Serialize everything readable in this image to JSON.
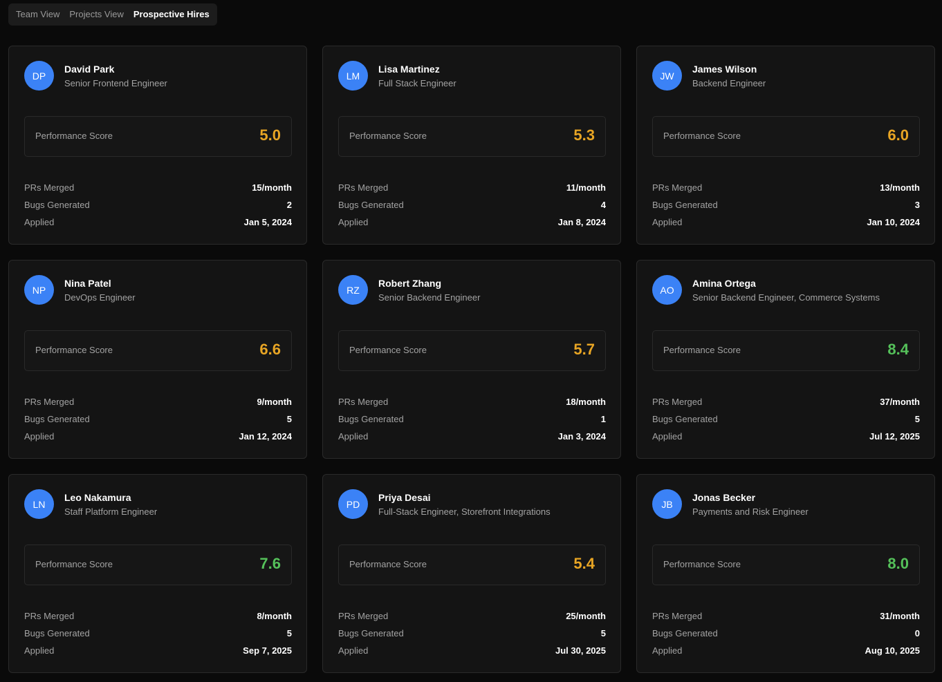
{
  "tabs": [
    {
      "label": "Team View",
      "active": false
    },
    {
      "label": "Projects View",
      "active": false
    },
    {
      "label": "Prospective Hires",
      "active": true
    }
  ],
  "labels": {
    "score": "Performance Score",
    "prs": "PRs Merged",
    "bugs": "Bugs Generated",
    "applied": "Applied"
  },
  "colors": {
    "avatar": "#3b82f6",
    "score_mid": "#e8a524",
    "score_high": "#55c15a"
  },
  "candidates": [
    {
      "initials": "DP",
      "name": "David Park",
      "role": "Senior Frontend Engineer",
      "score": "5.0",
      "level": "mid",
      "prs": "15/month",
      "bugs": "2",
      "applied": "Jan 5, 2024"
    },
    {
      "initials": "LM",
      "name": "Lisa Martinez",
      "role": "Full Stack Engineer",
      "score": "5.3",
      "level": "mid",
      "prs": "11/month",
      "bugs": "4",
      "applied": "Jan 8, 2024"
    },
    {
      "initials": "JW",
      "name": "James Wilson",
      "role": "Backend Engineer",
      "score": "6.0",
      "level": "mid",
      "prs": "13/month",
      "bugs": "3",
      "applied": "Jan 10, 2024"
    },
    {
      "initials": "NP",
      "name": "Nina Patel",
      "role": "DevOps Engineer",
      "score": "6.6",
      "level": "mid",
      "prs": "9/month",
      "bugs": "5",
      "applied": "Jan 12, 2024"
    },
    {
      "initials": "RZ",
      "name": "Robert Zhang",
      "role": "Senior Backend Engineer",
      "score": "5.7",
      "level": "mid",
      "prs": "18/month",
      "bugs": "1",
      "applied": "Jan 3, 2024"
    },
    {
      "initials": "AO",
      "name": "Amina Ortega",
      "role": "Senior Backend Engineer, Commerce Systems",
      "score": "8.4",
      "level": "high",
      "prs": "37/month",
      "bugs": "5",
      "applied": "Jul 12, 2025"
    },
    {
      "initials": "LN",
      "name": "Leo Nakamura",
      "role": "Staff Platform Engineer",
      "score": "7.6",
      "level": "high",
      "prs": "8/month",
      "bugs": "5",
      "applied": "Sep 7, 2025"
    },
    {
      "initials": "PD",
      "name": "Priya Desai",
      "role": "Full-Stack Engineer, Storefront Integrations",
      "score": "5.4",
      "level": "mid",
      "prs": "25/month",
      "bugs": "5",
      "applied": "Jul 30, 2025"
    },
    {
      "initials": "JB",
      "name": "Jonas Becker",
      "role": "Payments and Risk Engineer",
      "score": "8.0",
      "level": "high",
      "prs": "31/month",
      "bugs": "0",
      "applied": "Aug 10, 2025"
    }
  ]
}
